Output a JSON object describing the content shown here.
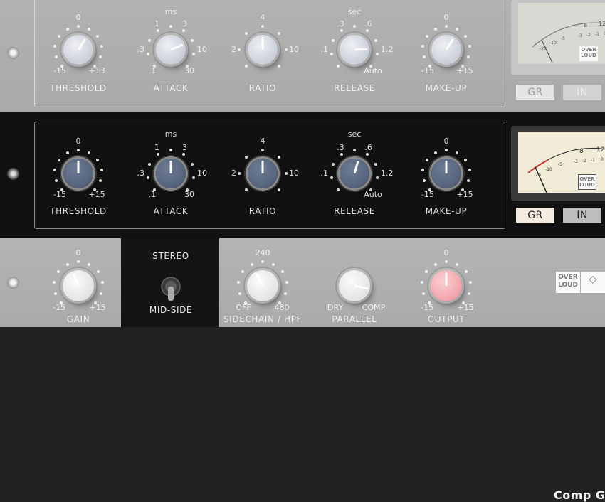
{
  "colors": {
    "top_bg": "#afafaf",
    "mid_bg": "#111111",
    "bottom_bg": "#b0b0b0",
    "mid_knob": "#56647d",
    "output_knob": "#f2a6ac",
    "bottom_knob": "#ebebeb",
    "top_knob": "#d6dae2"
  },
  "units": {
    "ms": "ms",
    "sec": "sec"
  },
  "knobs": {
    "threshold": {
      "label": "THRESHOLD",
      "ticks": {
        "top": "0",
        "bl": "-15",
        "br": "+15"
      }
    },
    "attack": {
      "label": "ATTACK",
      "ticks": {
        "tl": "1",
        "tr": "3",
        "left": ".3",
        "right": "10",
        "bl": ".1",
        "br": "30"
      }
    },
    "ratio": {
      "label": "RATIO",
      "ticks": {
        "top": "4",
        "left": "2",
        "right": "10"
      }
    },
    "release": {
      "label": "RELEASE",
      "ticks": {
        "tl": ".3",
        "tr": ".6",
        "left": ".1",
        "right": "1.2",
        "br": "Auto"
      }
    },
    "makeup": {
      "label": "MAKE-UP",
      "ticks": {
        "top": "0",
        "bl": "-15",
        "br": "+15"
      }
    }
  },
  "top_ticks": {
    "threshold_br": "+13"
  },
  "top_unit_ms": "ms",
  "top_unit_sec": "sec",
  "meter": {
    "scale": [
      "8",
      "12",
      "-3",
      "-2",
      "-1",
      "0",
      "-5",
      "-10",
      "-20",
      "1"
    ],
    "logo": [
      "OVER",
      "LOUD"
    ]
  },
  "buttons": {
    "gr": "GR",
    "in": "IN"
  },
  "bottom": {
    "gain": {
      "label": "GAIN",
      "top": "0",
      "bl": "-15",
      "br": "+15"
    },
    "switch": {
      "top": "STEREO",
      "bottom": "MID-SIDE"
    },
    "sidechain": {
      "label": "SIDECHAIN / HPF",
      "top": "240",
      "bl": "OFF",
      "br": "480"
    },
    "parallel": {
      "label": "PARALLEL",
      "bl": "DRY",
      "br": "COMP"
    },
    "output": {
      "label": "OUTPUT",
      "top": "0",
      "bl": "-15",
      "br": "+15"
    },
    "title": "Comp G",
    "logo": [
      "OVER",
      "LOUD"
    ]
  },
  "knob_values": {
    "top": {
      "threshold": 0.62,
      "attack": 0.75,
      "ratio": 0.5,
      "release": 0.83,
      "makeup": 0.62
    },
    "mid": {
      "threshold": 0.5,
      "attack": 0.5,
      "ratio": 0.5,
      "release": 0.56,
      "makeup": 0.5
    },
    "bottom": {
      "gain": 0.42,
      "sidechain": 0.4,
      "parallel": 0.88,
      "output": 0.5
    }
  }
}
